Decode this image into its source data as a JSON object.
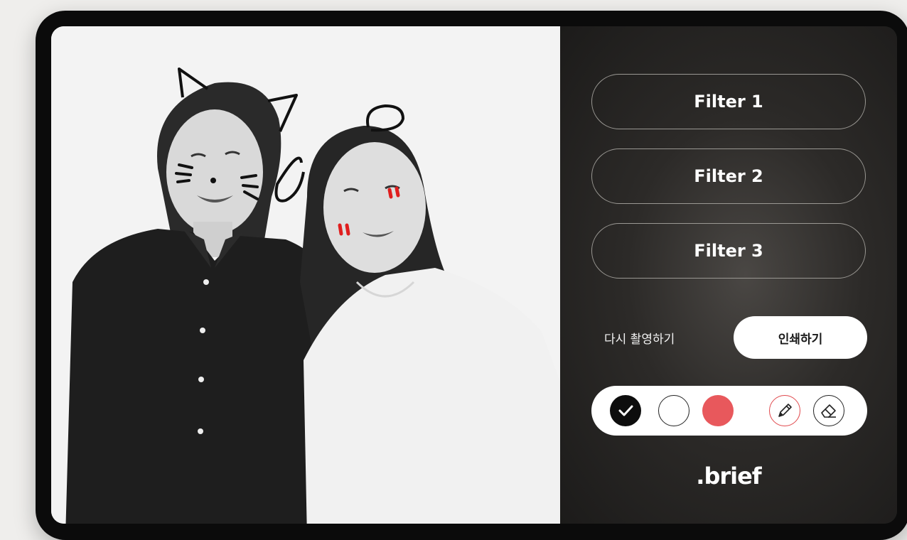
{
  "filters": [
    {
      "label": "Filter 1"
    },
    {
      "label": "Filter 2"
    },
    {
      "label": "Filter 3"
    }
  ],
  "actions": {
    "retake_label": "다시 촬영하기",
    "print_label": "인쇄하기"
  },
  "toolbar": {
    "colors": [
      {
        "name": "black",
        "hex": "#0d0d0d",
        "selected": true
      },
      {
        "name": "white",
        "hex": "#ffffff",
        "selected": false
      },
      {
        "name": "red",
        "hex": "#e8585c",
        "selected": false
      }
    ],
    "tools": [
      "pencil-icon",
      "eraser-icon"
    ]
  },
  "brand": {
    "logo_text": ".brief"
  }
}
